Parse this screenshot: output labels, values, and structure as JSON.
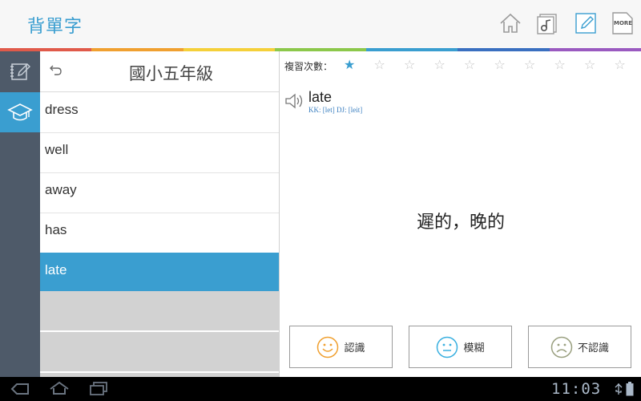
{
  "app": {
    "title": "背單字"
  },
  "header_icons": [
    "home-icon",
    "music-note-icon",
    "edit-note-icon",
    "more-icon"
  ],
  "header_more_label": "MORE",
  "rainbow_colors": [
    "#e05a4a",
    "#f0a030",
    "#f5d03a",
    "#8cc84b",
    "#3a9ed0",
    "#3a6fc0",
    "#9a5ac0"
  ],
  "list": {
    "title": "國小五年級",
    "words": [
      "dress",
      "well",
      "away",
      "has",
      "late"
    ],
    "selected_index": 4
  },
  "detail": {
    "review_label": "複習次數：",
    "stars_total": 10,
    "stars_filled": 1,
    "word": "late",
    "phonetic": "KK: [let]  DJ: [leit]",
    "meaning": "遲的，晚的",
    "buttons": [
      {
        "label": "認識",
        "face": "smile-face-icon",
        "color": "#f0a030"
      },
      {
        "label": "模糊",
        "face": "neutral-face-icon",
        "color": "#3ab0e0"
      },
      {
        "label": "不認識",
        "face": "sad-face-icon",
        "color": "#9aa080"
      }
    ]
  },
  "status_bar": {
    "time": "11:03"
  },
  "colors": {
    "accent": "#3a9ed0",
    "rail": "#4e5a69"
  }
}
